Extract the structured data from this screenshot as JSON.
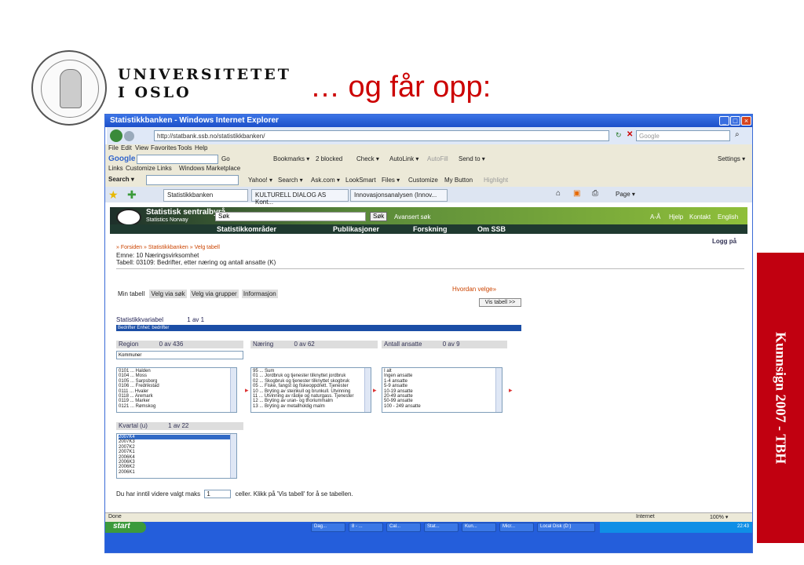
{
  "slide": {
    "university_line1": "UNIVERSITETET",
    "university_line2": "I OSLO",
    "title": "… og får opp:",
    "sidebar_text": "Kunnsign 2007 - TBH"
  },
  "window": {
    "title": "Statistikkbanken - Windows Internet Explorer"
  },
  "browser": {
    "url": "http://statbank.ssb.no/statistikkbanken/",
    "search_placeholder": "Google",
    "menu": [
      "File",
      "Edit",
      "View",
      "Favorites",
      "Tools",
      "Help"
    ],
    "google_go": "Go",
    "google_items": [
      "Bookmarks ▾",
      "2 blocked",
      "Check ▾",
      "AutoLink ▾",
      "AutoFill",
      "Send to ▾"
    ],
    "settings": "Settings ▾",
    "links_label": "Links",
    "links": [
      "Customize Links",
      "Windows Marketplace"
    ],
    "search_label": "Search ▾",
    "ytb_items": [
      "Yahoo! ▾",
      "Search ▾",
      "Ask.com ▾",
      "LookSmart",
      "Files ▾",
      "Customize",
      "My Button",
      "Highlight"
    ],
    "tabs": [
      "Statistikkbanken",
      "KULTURELL DIALOG AS Kont...",
      "Innovasjonsanalysen (Innov..."
    ],
    "page_menu": "Page ▾"
  },
  "ssb": {
    "name": "Statistisk sentralbyrå",
    "name_en": "Statistics Norway",
    "search_value": "Søk",
    "search_btn": "Søk",
    "advanced": "Avansert søk",
    "top_links": [
      "A-Å",
      "Hjelp",
      "Kontakt",
      "English"
    ],
    "nav": [
      "Statistikkområder",
      "Publikasjoner",
      "Forskning",
      "Om SSB"
    ],
    "login": "Logg på",
    "breadcrumb": "» Forsiden » Statistikkbanken » Velg tabell",
    "emne": "Emne: 10 Næringsvirksomhet",
    "tabell": "Tabell: 03109: Bedrifter, etter næring og antall ansatte (K)",
    "hvordan": "Hvordan velge»",
    "vis_tabell": "Vis tabell >>",
    "tabs": [
      "Min tabell",
      "Velg via søk",
      "Velg via grupper",
      "Informasjon"
    ],
    "statvar_label": "Statistikkvariabel",
    "statvar_count": "1 av 1",
    "statvar_item": "Bedrifter    Enhet: bedrifter",
    "region": {
      "label": "Region",
      "count": "0 av 436",
      "dropdown": "Kommuner",
      "items": [
        "0101 ... Halden",
        "0104 ... Moss",
        "0105 ... Sarpsborg",
        "0106 ... Fredrikstad",
        "0111 ... Hvaler",
        "0118 ... Aremark",
        "0119 ... Marker",
        "0121 ... Rømskog"
      ]
    },
    "naering": {
      "label": "Næring",
      "count": "0 av 62",
      "items": [
        "95 ... Sum",
        "01 ... Jordbruk og tjenester tilknyttet jordbruk",
        "02 ... Skogbruk og tjenester tilknyttet skogbruk",
        "05 ... Fiske, fangst og fiskeoppdrett. Tjenester",
        "10 ... Bryting av steinkull og brunkull. Utvinning",
        "11 ... Utvinning av råolje og naturgass. Tjenester",
        "12 ... Bryting av uran- og thoriummalm",
        "13 ... Bryting av metallholdig malm"
      ]
    },
    "ansatte": {
      "label": "Antall ansatte",
      "count": "0 av 9",
      "items": [
        "I alt",
        "Ingen ansatte",
        "1-4 ansatte",
        "5-9 ansatte",
        "10-19 ansatte",
        "20-49 ansatte",
        "50-99 ansatte",
        "100 - 249 ansatte"
      ]
    },
    "kvartal": {
      "label": "Kvartal (u)",
      "count": "1 av 22",
      "items": [
        "2007K4",
        "2007K3",
        "2007K2",
        "2007K1",
        "2006K4",
        "2006K3",
        "2006K2",
        "2006K1"
      ]
    },
    "note_pre": "Du har inntil videre valgt maks",
    "note_value": "1",
    "note_post": "celler. Klikk på 'Vis tabell' for å se tabellen."
  },
  "status": {
    "left": "Done",
    "zone": "Internet",
    "zoom": "100% ▾"
  },
  "taskbar": {
    "start": "start",
    "tasks": [
      "Dag...",
      "8 - ...",
      "Cal...",
      "Stat...",
      "Kun...",
      "Micr...",
      "Local Disk (D:)"
    ],
    "clock": "22:43"
  }
}
